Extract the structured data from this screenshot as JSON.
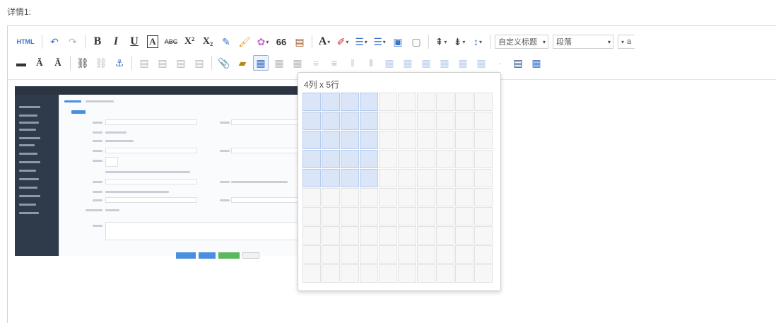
{
  "field": {
    "label": "详情1:"
  },
  "toolbar": {
    "html_label": "HTML",
    "bold": "B",
    "italic": "I",
    "underline": "U",
    "border_char": "A",
    "strike": "ABC",
    "superscript": "X²",
    "subscript": "X₂",
    "quote": "66",
    "font_color": "A",
    "custom_heading": "自定义标题",
    "paragraph": "段落",
    "font_family_partial": "a"
  },
  "table_picker": {
    "size_label": "4列 x 5行",
    "columns": 10,
    "rows": 10,
    "selected_cols": 4,
    "selected_rows": 5
  },
  "colors": {
    "selected_cell": "#dae6f8",
    "embedded_sidebar": "#2f3a4b",
    "btn_blue": "#4a8ee0",
    "btn_green": "#5cb85c"
  }
}
